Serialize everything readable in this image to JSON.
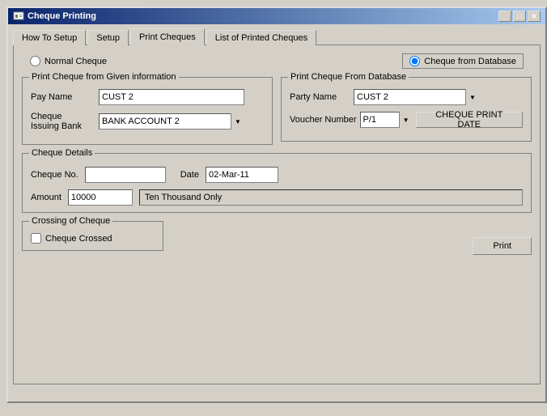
{
  "window": {
    "title": "Cheque Printing",
    "minimize_label": "_",
    "maximize_label": "□",
    "close_label": "✕"
  },
  "tabs": [
    {
      "id": "how-to-setup",
      "label": "How To Setup",
      "active": false
    },
    {
      "id": "setup",
      "label": "Setup",
      "active": false
    },
    {
      "id": "print-cheques",
      "label": "Print Cheques",
      "active": true
    },
    {
      "id": "list-of-printed-cheques",
      "label": "List of Printed Cheques",
      "active": false
    }
  ],
  "radio_options": {
    "normal_cheque": {
      "label": "Normal Cheque",
      "checked": false
    },
    "cheque_from_database": {
      "label": "Cheque from Database",
      "checked": true
    }
  },
  "left_panel": {
    "title": "Print Cheque from Given information",
    "pay_name_label": "Pay Name",
    "pay_name_value": "CUST 2",
    "cheque_issuing_bank_label": "Cheque Issuing Bank",
    "bank_options": [
      "BANK ACCOUNT 2"
    ],
    "bank_selected": "BANK ACCOUNT 2"
  },
  "right_panel": {
    "title": "Print Cheque From Database",
    "party_name_label": "Party Name",
    "party_name_options": [
      "CUST 2"
    ],
    "party_name_selected": "CUST 2",
    "voucher_number_label": "Voucher Number",
    "voucher_options": [
      "P/1"
    ],
    "voucher_selected": "P/1",
    "cheque_print_date_label": "CHEQUE PRINT DATE"
  },
  "cheque_details": {
    "title": "Cheque Details",
    "cheque_no_label": "Cheque No.",
    "cheque_no_value": "",
    "date_label": "Date",
    "date_value": "02-Mar-11",
    "amount_label": "Amount",
    "amount_value": "10000",
    "amount_text": "Ten Thousand Only"
  },
  "crossing": {
    "title": "Crossing of Cheque",
    "cheque_crossed_label": "Cheque Crossed",
    "cheque_crossed_checked": false
  },
  "print_button_label": "Print"
}
